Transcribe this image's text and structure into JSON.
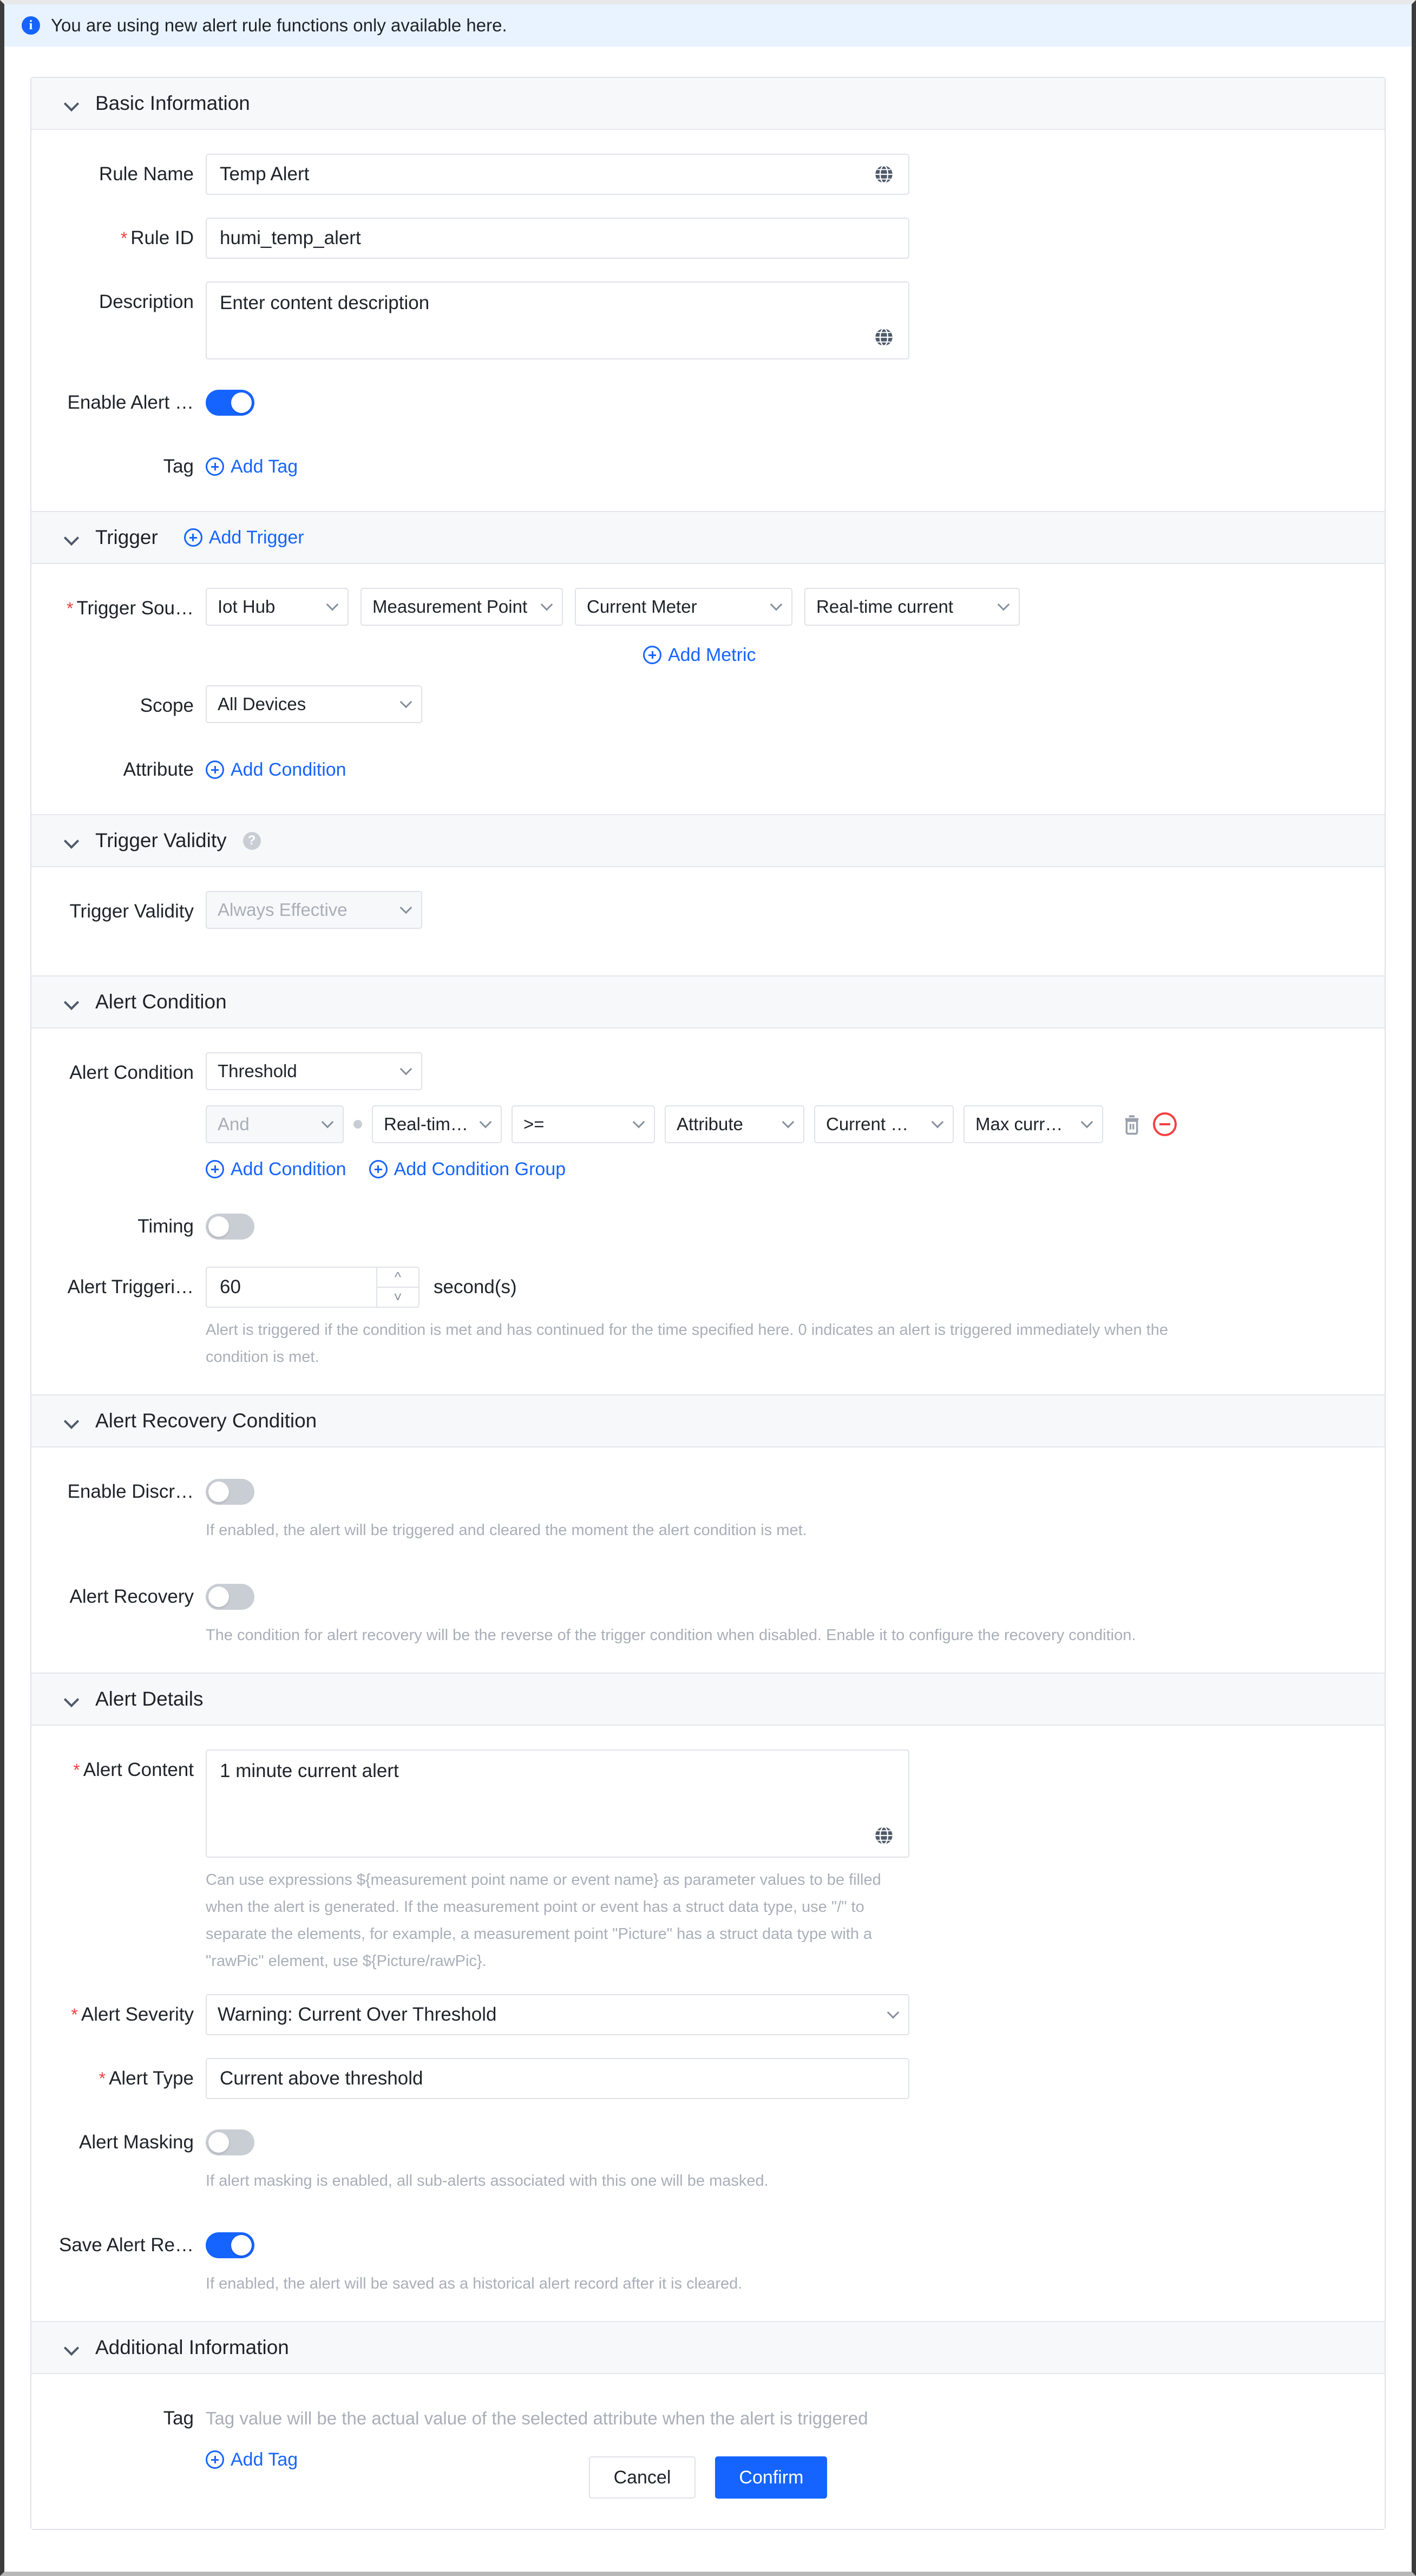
{
  "banner": {
    "icon": "info-circle-icon",
    "text": "You are using new alert rule functions only available here."
  },
  "sections": {
    "basic_information": {
      "title": "Basic Information",
      "rule_name": {
        "label": "Rule Name",
        "value": "Temp Alert",
        "icon": "globe-icon"
      },
      "rule_id": {
        "label": "Rule ID",
        "value": "humi_temp_alert",
        "required": true
      },
      "description": {
        "label": "Description",
        "value": "",
        "placeholder": "Enter content description",
        "icon": "globe-icon"
      },
      "enable_alert": {
        "label": "Enable Alert …",
        "state": "on"
      },
      "tag": {
        "label": "Tag",
        "add_label": "Add Tag"
      }
    },
    "trigger": {
      "title": "Trigger",
      "add_trigger_label": "Add Trigger",
      "trigger_source": {
        "label": "Trigger Sou…",
        "required": true,
        "selects": [
          "Iot Hub",
          "Measurement Point",
          "Current Meter",
          "Real-time current"
        ]
      },
      "add_metric_label": "Add Metric",
      "scope": {
        "label": "Scope",
        "value": "All Devices"
      },
      "attribute": {
        "label": "Attribute",
        "add_label": "Add Condition"
      }
    },
    "trigger_validity": {
      "title": "Trigger Validity",
      "help_icon": "question-mark-icon",
      "field": {
        "label": "Trigger Validity",
        "value": "Always Effective",
        "disabled": true
      }
    },
    "alert_condition": {
      "title": "Alert Condition",
      "condition_type": {
        "label": "Alert Condition",
        "value": "Threshold"
      },
      "condition_row": {
        "logic": "And",
        "metric": "Real-time…",
        "operator": ">=",
        "source": "Attribute",
        "field": "Current …",
        "value": "Max curr…",
        "delete_icon": "trash-icon",
        "remove_icon": "minus-circle-icon"
      },
      "add_condition_label": "Add Condition",
      "add_condition_group_label": "Add Condition Group",
      "timing": {
        "label": "Timing",
        "state": "off"
      },
      "alert_triggering": {
        "label": "Alert Triggeri…",
        "value": "60",
        "unit": "second(s)",
        "hint": "Alert is triggered if the condition is met and has continued for the time specified here. 0 indicates an alert is triggered immediately when the condition is met."
      }
    },
    "alert_recovery_condition": {
      "title": "Alert Recovery Condition",
      "enable_discrete": {
        "label": "Enable Discr…",
        "state": "off",
        "hint": "If enabled, the alert will be triggered and cleared the moment the alert condition is met."
      },
      "alert_recovery": {
        "label": "Alert Recovery",
        "state": "off",
        "hint": "The condition for alert recovery will be the reverse of the trigger condition when disabled. Enable it to configure the recovery condition."
      }
    },
    "alert_details": {
      "title": "Alert Details",
      "alert_content": {
        "label": "Alert Content",
        "required": true,
        "value": "1 minute current alert",
        "icon": "globe-icon",
        "hint": "Can use expressions ${measurement point name or event name} as parameter values to be filled when the alert is generated. If the measurement point or event has a struct data type, use \"/\" to separate the elements, for example, a measurement point \"Picture\" has a struct data type with a \"rawPic\" element, use ${Picture/rawPic}."
      },
      "alert_severity": {
        "label": "Alert Severity",
        "required": true,
        "value": "Warning: Current Over Threshold"
      },
      "alert_type": {
        "label": "Alert Type",
        "required": true,
        "value": "Current above threshold"
      },
      "alert_masking": {
        "label": "Alert Masking",
        "state": "off",
        "hint": "If alert masking is enabled, all sub-alerts associated with this one will be masked."
      },
      "save_alert_record": {
        "label": "Save Alert Re…",
        "state": "on",
        "hint": "If enabled, the alert will be saved as a historical alert record after it is cleared."
      }
    },
    "additional_information": {
      "title": "Additional Information",
      "tag": {
        "label": "Tag",
        "placeholder": "Tag value will be the actual value of the selected attribute when the alert is triggered",
        "add_label": "Add Tag"
      }
    }
  },
  "footer": {
    "cancel_label": "Cancel",
    "confirm_label": "Confirm"
  },
  "colors": {
    "accent": "#1664ff",
    "required": "#f53f3f",
    "banner_bg": "#e8f3ff",
    "section_header_bg": "#f7f8fa",
    "border": "#dfe2e8",
    "muted_text": "#a9aeb8"
  }
}
